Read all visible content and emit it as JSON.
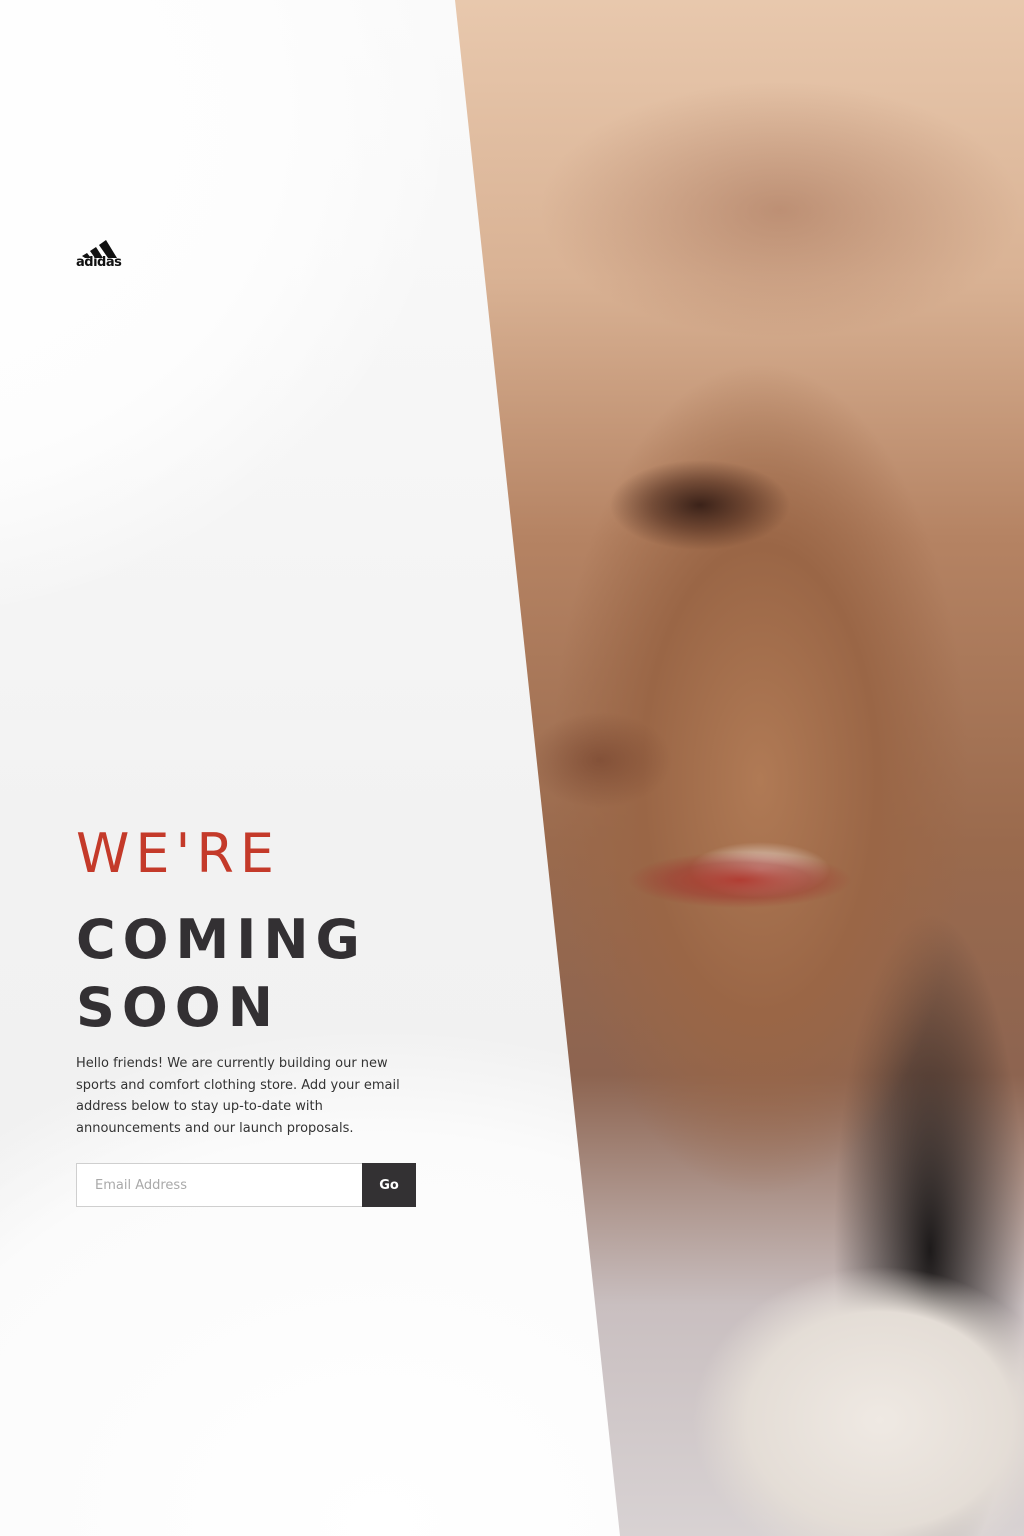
{
  "brand": {
    "logo_text": "adidas",
    "logo_icon": "adidas-performance-logo"
  },
  "hero": {
    "headline_line1": "WE'RE",
    "headline_line2": "COMING",
    "headline_line3": "SOON",
    "description": "Hello friends! We are currently building our new sports and comfort clothing store. Add your email address below to stay up-to-date with announcements and our launch proposals."
  },
  "signup": {
    "email_placeholder": "Email Address",
    "email_value": "",
    "submit_label": "Go"
  },
  "colors": {
    "accent": "#c43a2a",
    "heading": "#333033",
    "button": "#333133"
  }
}
